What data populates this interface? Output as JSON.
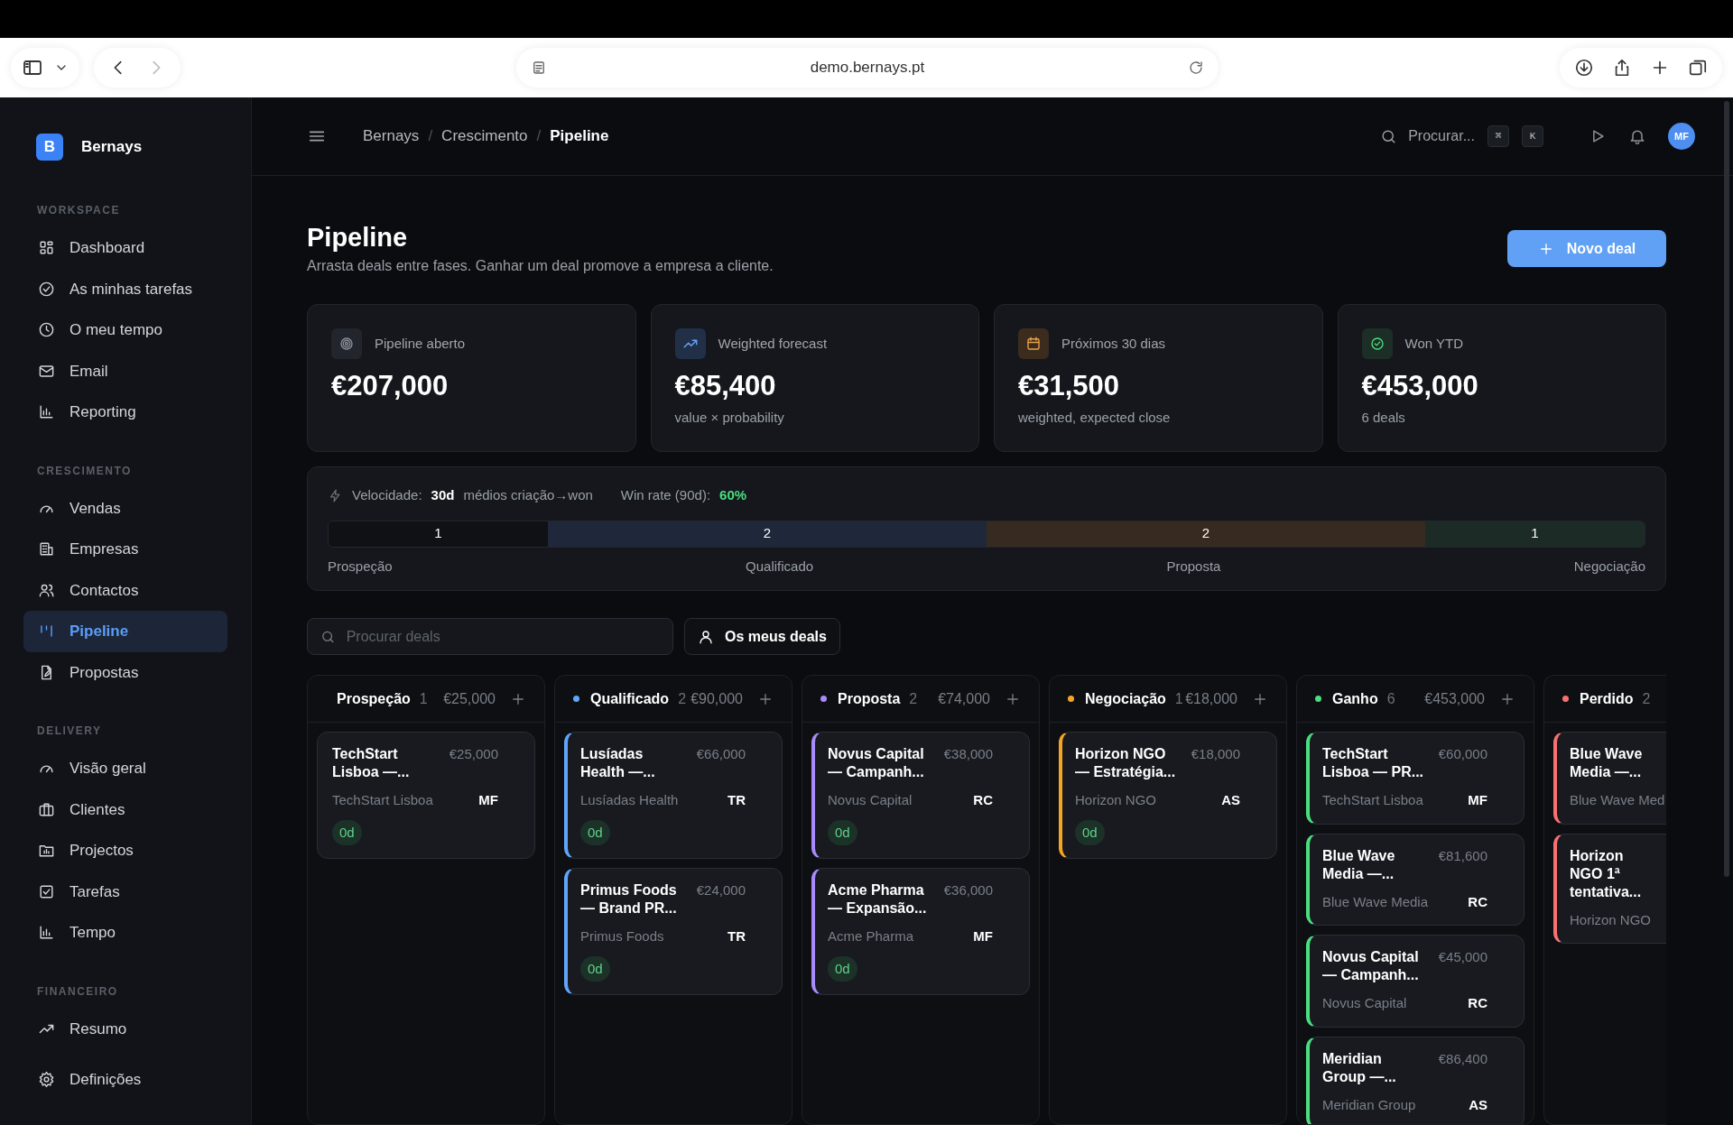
{
  "browser": {
    "url": "demo.bernays.pt"
  },
  "sidebar": {
    "brand": {
      "initial": "B",
      "name": "Bernays"
    },
    "sections": [
      {
        "title": "WORKSPACE",
        "items": [
          {
            "label": "Dashboard",
            "selected": false
          },
          {
            "label": "As minhas tarefas",
            "selected": false
          },
          {
            "label": "O meu tempo",
            "selected": false
          },
          {
            "label": "Email",
            "selected": false
          },
          {
            "label": "Reporting",
            "selected": false
          }
        ]
      },
      {
        "title": "CRESCIMENTO",
        "items": [
          {
            "label": "Vendas",
            "selected": false
          },
          {
            "label": "Empresas",
            "selected": false
          },
          {
            "label": "Contactos",
            "selected": false
          },
          {
            "label": "Pipeline",
            "selected": true
          },
          {
            "label": "Propostas",
            "selected": false
          }
        ]
      },
      {
        "title": "DELIVERY",
        "items": [
          {
            "label": "Visão geral",
            "selected": false
          },
          {
            "label": "Clientes",
            "selected": false
          },
          {
            "label": "Projectos",
            "selected": false
          },
          {
            "label": "Tarefas",
            "selected": false
          },
          {
            "label": "Tempo",
            "selected": false
          }
        ]
      },
      {
        "title": "FINANCEIRO",
        "items": [
          {
            "label": "Resumo",
            "selected": false
          }
        ]
      }
    ],
    "settings": {
      "label": "Definições",
      "selected": false
    }
  },
  "header": {
    "breadcrumbs": [
      "Bernays",
      "Crescimento",
      "Pipeline"
    ],
    "breadcrumb_separator": "/",
    "search": {
      "placeholder": "Procurar..."
    },
    "shortcut": [
      "⌘",
      "K"
    ],
    "avatar": "MF"
  },
  "page": {
    "title": "Pipeline",
    "subtitle": "Arrasta deals entre fases. Ganhar um deal promove a empresa a cliente.",
    "new_button": "Novo deal"
  },
  "stats": [
    {
      "label": "Pipeline aberto",
      "value": "€207,000"
    },
    {
      "label": "Weighted forecast",
      "value": "€85,400",
      "note": "value × probability"
    },
    {
      "label": "Próximos 30 dias",
      "value": "€31,500",
      "note": "weighted, expected close"
    },
    {
      "label": "Won YTD",
      "value": "€453,000",
      "note": "6 deals"
    }
  ],
  "velocity": {
    "label": "Velocidade:",
    "days": "30d",
    "days_note": "médios criação→won",
    "win_rate_label": "Win rate (90d):",
    "win_rate": "60%",
    "segments": [
      {
        "count": "1",
        "label": "Prospeção",
        "color": "#0f1115"
      },
      {
        "count": "2",
        "label": "Qualificado",
        "color": "#1e283a"
      },
      {
        "count": "2",
        "label": "Proposta",
        "color": "#372a20"
      },
      {
        "count": "1",
        "label": "Negociação",
        "color": "#1d2b26"
      }
    ]
  },
  "filters": {
    "search": {
      "placeholder": "Procurar deals"
    },
    "mine_button": "Os meus deals"
  },
  "columns": [
    {
      "name": "Prospeção",
      "count": "1",
      "total": "€25,000",
      "cards": [
        {
          "title": "TechStart Lisboa —...",
          "value": "€25,000",
          "company": "TechStart Lisboa",
          "owner": "MF",
          "age": "0d"
        }
      ]
    },
    {
      "name": "Qualificado",
      "count": "2",
      "total": "€90,000",
      "color": "#60a5fa",
      "cards": [
        {
          "title": "Lusíadas Health —...",
          "value": "€66,000",
          "company": "Lusíadas Health",
          "owner": "TR",
          "age": "0d"
        },
        {
          "title": "Primus Foods — Brand PR...",
          "value": "€24,000",
          "company": "Primus Foods",
          "owner": "TR",
          "age": "0d"
        }
      ]
    },
    {
      "name": "Proposta",
      "count": "2",
      "total": "€74,000",
      "color": "#a78bfa",
      "cards": [
        {
          "title": "Novus Capital — Campanh...",
          "value": "€38,000",
          "company": "Novus Capital",
          "owner": "RC",
          "age": "0d"
        },
        {
          "title": "Acme Pharma — Expansão...",
          "value": "€36,000",
          "company": "Acme Pharma",
          "owner": "MF",
          "age": "0d"
        }
      ]
    },
    {
      "name": "Negociação",
      "count": "1",
      "total": "€18,000",
      "color": "#f5a524",
      "cards": [
        {
          "title": "Horizon NGO — Estratégia...",
          "value": "€18,000",
          "company": "Horizon NGO",
          "owner": "AS",
          "age": "0d"
        }
      ]
    },
    {
      "name": "Ganho",
      "count": "6",
      "total": "€453,000",
      "color": "#4ade80",
      "cards": [
        {
          "title": "TechStart Lisboa — PR...",
          "value": "€60,000",
          "company": "TechStart Lisboa",
          "owner": "MF"
        },
        {
          "title": "Blue Wave Media —...",
          "value": "€81,600",
          "company": "Blue Wave Media",
          "owner": "RC"
        },
        {
          "title": "Novus Capital — Campanh...",
          "value": "€45,000",
          "company": "Novus Capital",
          "owner": "RC"
        },
        {
          "title": "Meridian Group —...",
          "value": "€86,400",
          "company": "Meridian Group",
          "owner": "AS"
        }
      ]
    },
    {
      "name": "Perdido",
      "count": "2",
      "color": "#f87171",
      "cards": [
        {
          "title": "Blue Wave Media —...",
          "company": "Blue Wave Med"
        },
        {
          "title": "Horizon NGO 1ª tentativa...",
          "company": "Horizon NGO"
        }
      ]
    }
  ]
}
